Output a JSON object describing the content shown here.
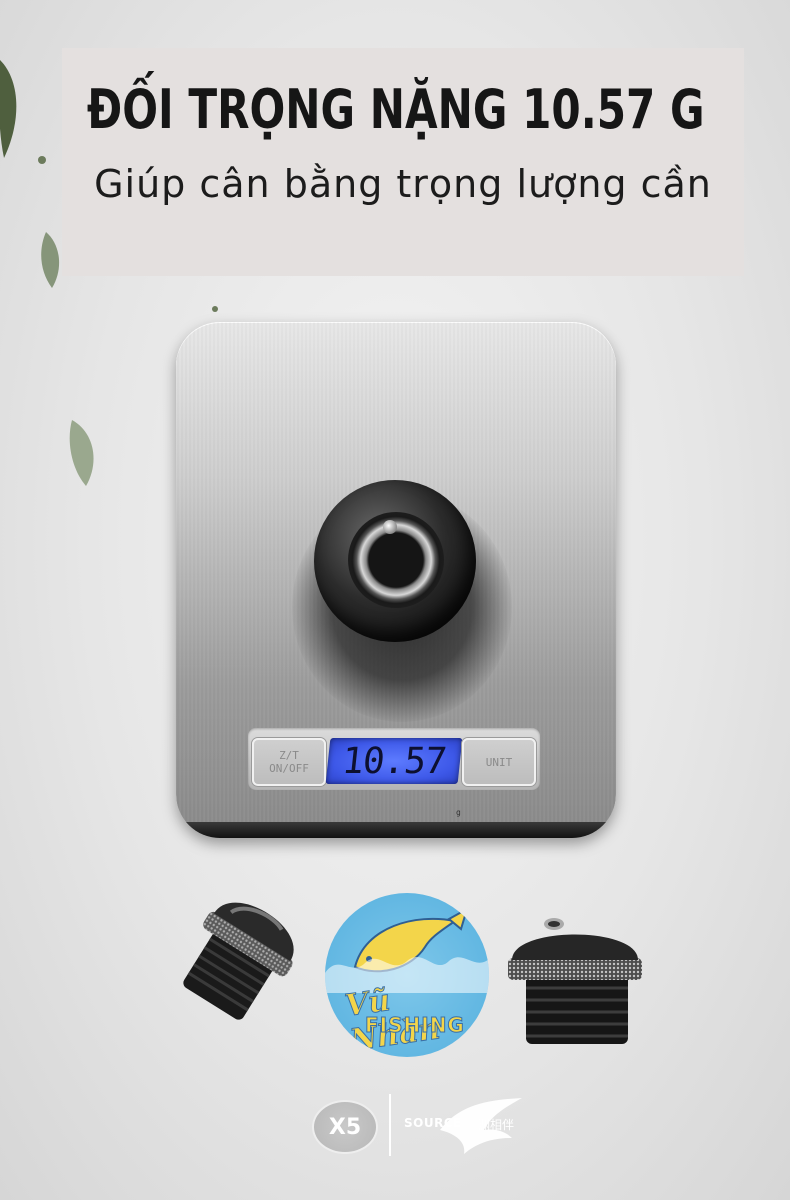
{
  "banner": {
    "title": "ĐỐI TRỌNG NẶNG 10.57 G",
    "subtitle": "Giúp cân bằng trọng lượng cần"
  },
  "scale": {
    "display_value": "10.57",
    "left_key": {
      "line1": "Z/T",
      "line2": "ON/OFF"
    },
    "right_key": "UNIT",
    "unit_mark": "g"
  },
  "logo": {
    "line1": "Vũ Nhàn",
    "line2": "FISHING"
  },
  "brand": {
    "badge": "X5",
    "name": "SOURCE",
    "chinese": "渊相伴"
  },
  "colors": {
    "banner_bg": "#e4e0df",
    "lcd_blue": "#3d58e8",
    "logo_blue": "#62b7e2",
    "logo_yellow": "#f3d54a"
  }
}
